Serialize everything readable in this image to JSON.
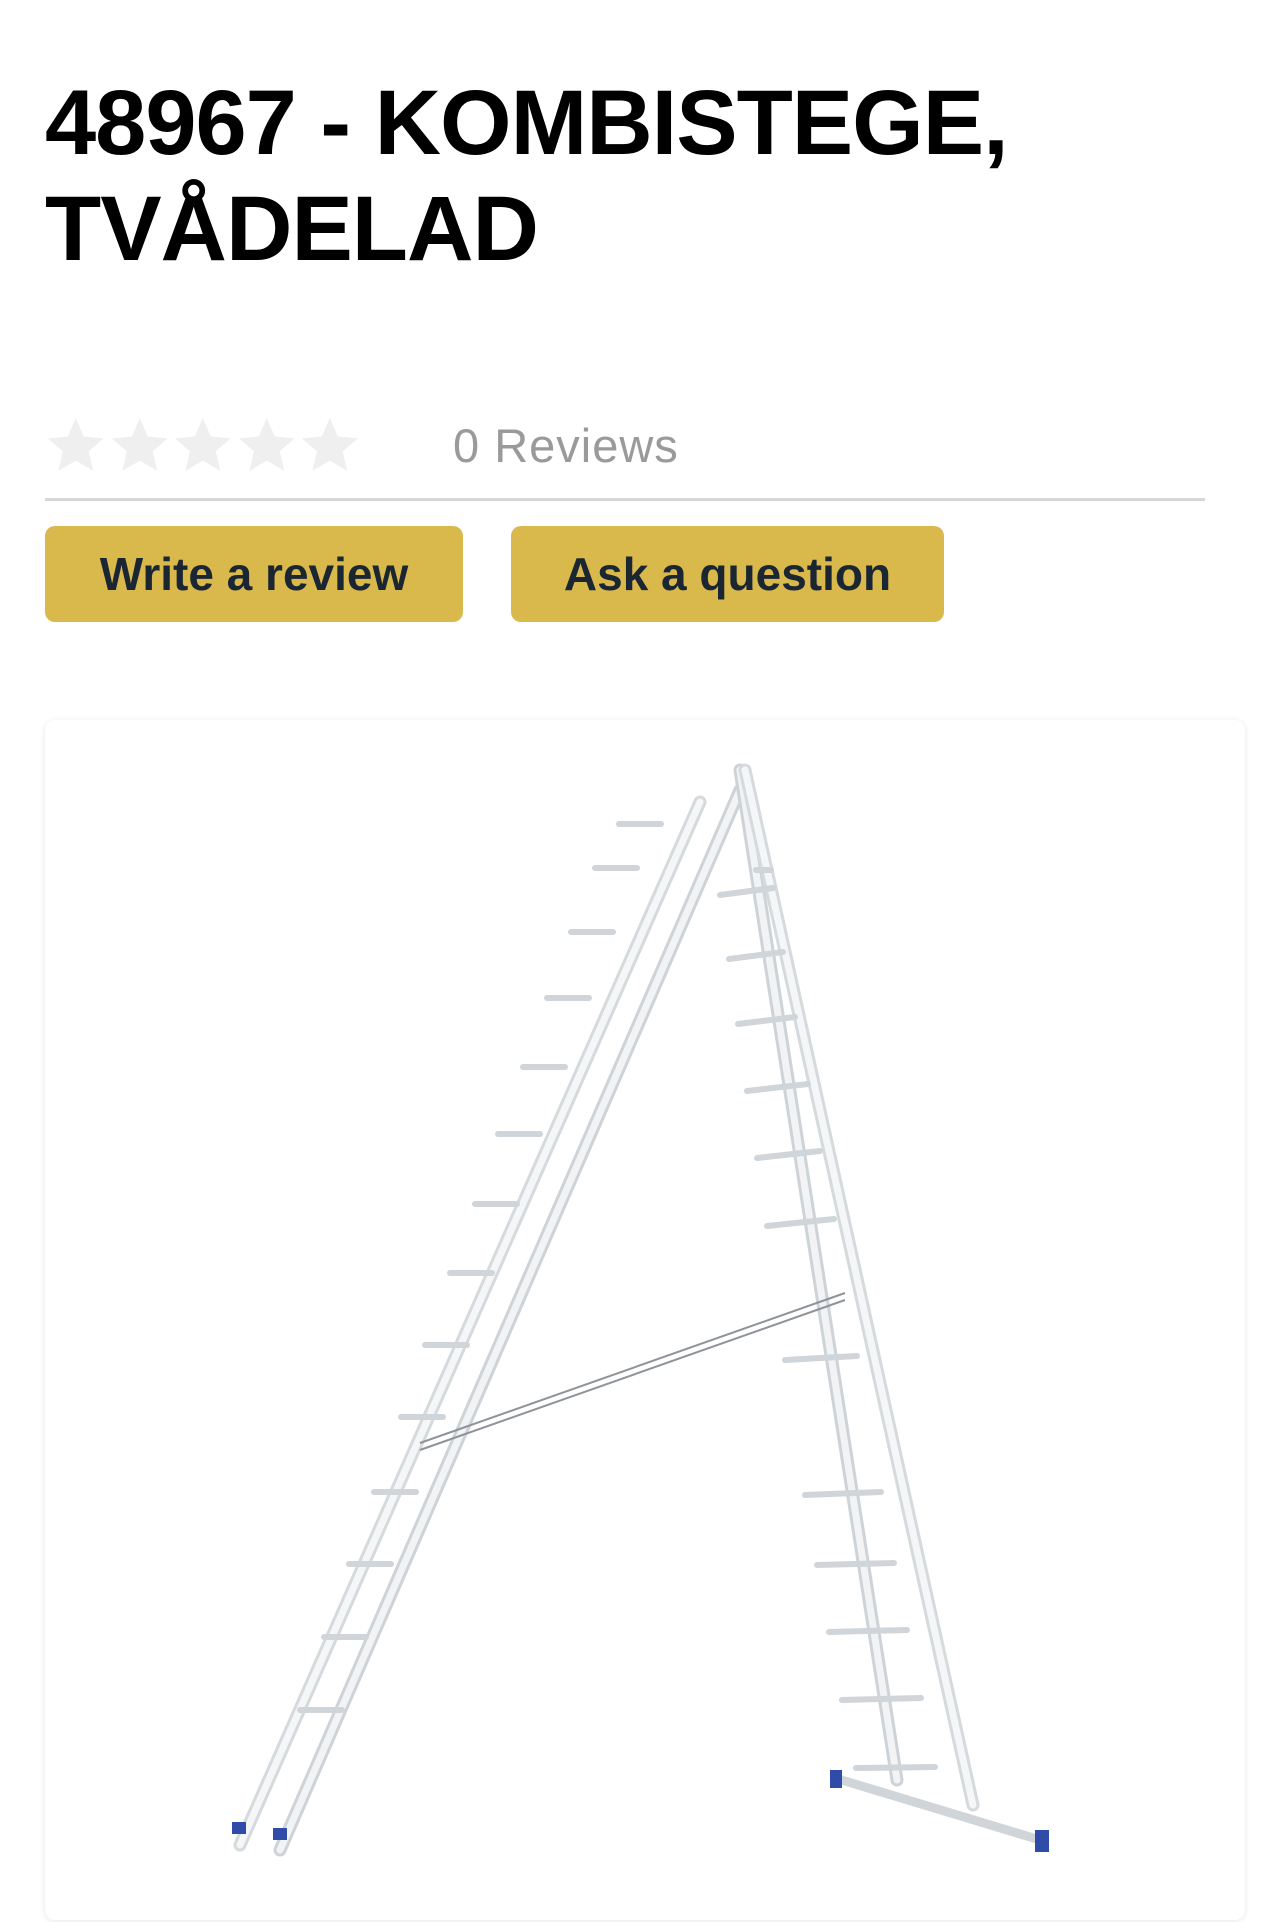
{
  "product": {
    "title_line1": "48967 - KOMBISTEGE,",
    "title_line2": "TVÅDELAD"
  },
  "rating": {
    "stars_filled": 0,
    "stars_total": 5,
    "reviews_text": "0 Reviews"
  },
  "actions": {
    "write_review_label": "Write a review",
    "ask_question_label": "Ask a question"
  },
  "colors": {
    "button_bg": "#d9b84c",
    "button_text": "#1b2633",
    "star_empty": "#efefef",
    "muted_text": "#9a9a9a"
  },
  "icons": {
    "star": "star-icon"
  }
}
